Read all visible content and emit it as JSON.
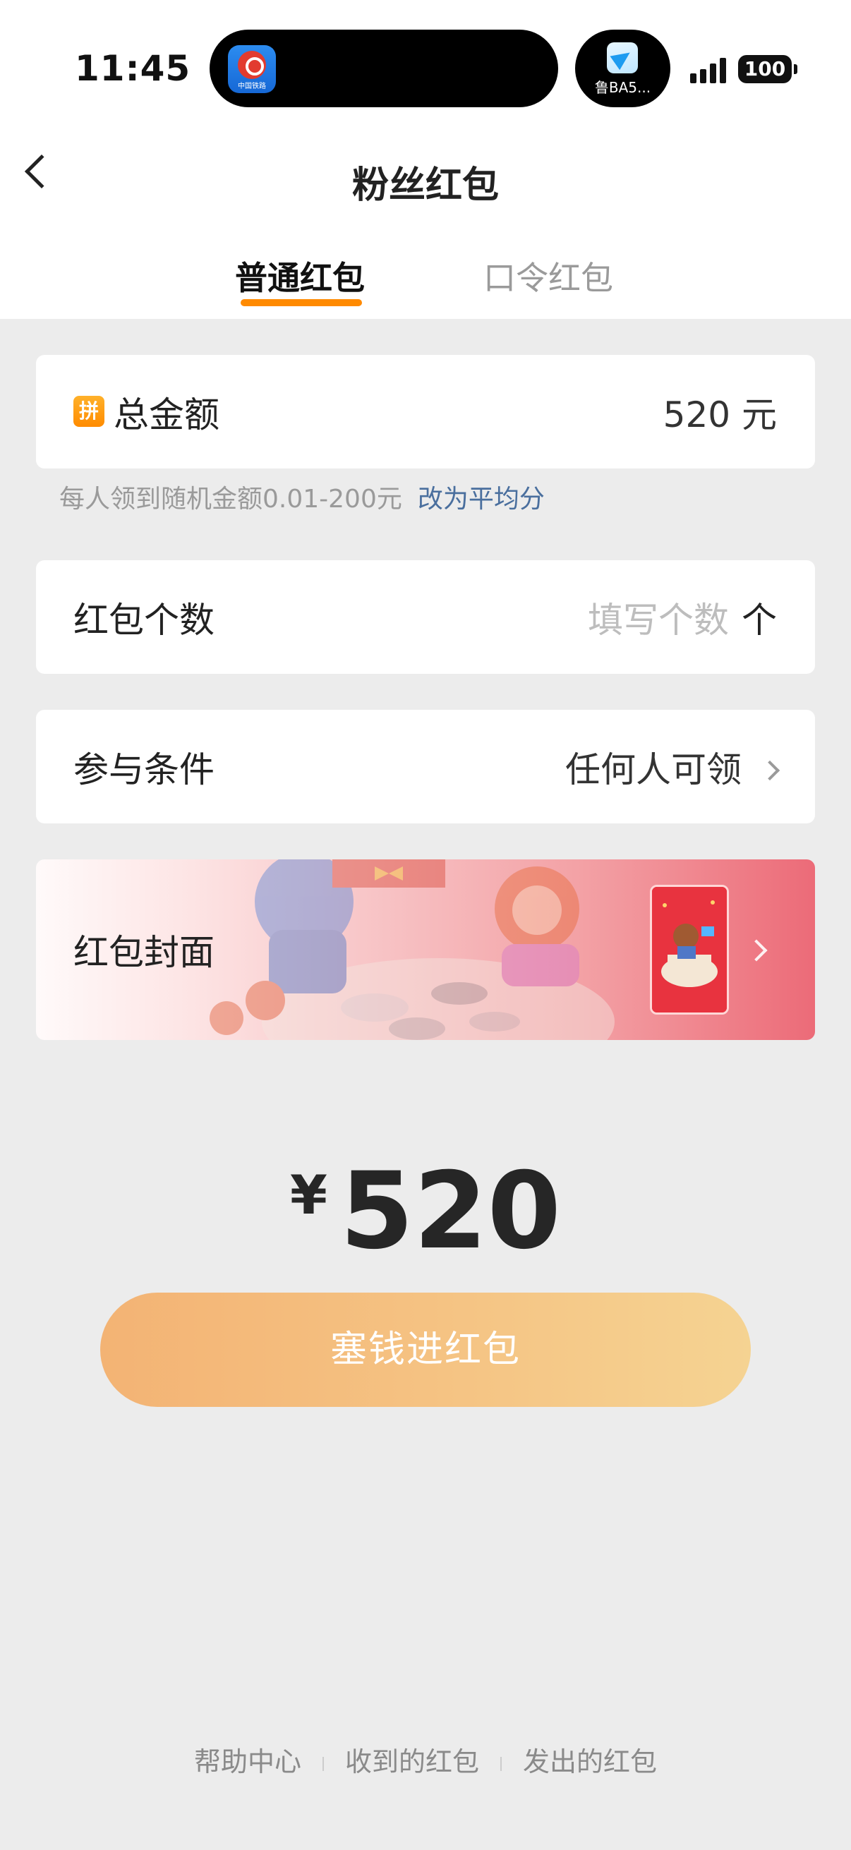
{
  "status_bar": {
    "time": "11:45",
    "island_app_text": "中国铁路",
    "live_activity_text": "鲁BA5...",
    "battery": "100"
  },
  "nav": {
    "title": "粉丝红包",
    "tabs": [
      {
        "label": "普通红包",
        "active": true
      },
      {
        "label": "口令红包",
        "active": false
      }
    ]
  },
  "total_amount": {
    "badge": "拼",
    "label": "总金额",
    "value": "520 元",
    "hint": "每人领到随机金额0.01-200元",
    "hint_link": "改为平均分"
  },
  "count": {
    "label": "红包个数",
    "placeholder": "填写个数",
    "unit": "个"
  },
  "condition": {
    "label": "参与条件",
    "value": "任何人可领"
  },
  "cover": {
    "label": "红包封面"
  },
  "amount_display": {
    "currency": "¥",
    "value": "520"
  },
  "submit": {
    "label": "塞钱进红包"
  },
  "footer": {
    "links": [
      "帮助中心",
      "收到的红包",
      "发出的红包"
    ]
  },
  "colors": {
    "accent": "#ff8a00",
    "link": "#4a6f9e",
    "button_start": "#f3b374",
    "button_end": "#f5d392"
  }
}
